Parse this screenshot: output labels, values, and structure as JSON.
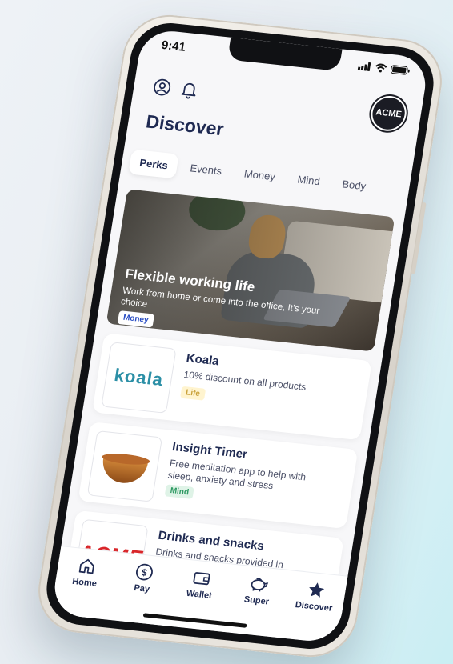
{
  "status": {
    "time": "9:41"
  },
  "header": {
    "title": "Discover",
    "logo_text": "ACME"
  },
  "tabs": [
    {
      "label": "Perks",
      "active": true
    },
    {
      "label": "Events",
      "active": false
    },
    {
      "label": "Money",
      "active": false
    },
    {
      "label": "Mind",
      "active": false
    },
    {
      "label": "Body",
      "active": false
    }
  ],
  "hero": {
    "title": "Flexible working life",
    "subtitle": "Work from home or come into the office, It's your choice",
    "badge": "Money"
  },
  "perks": [
    {
      "title": "Koala",
      "description": "10% discount on all products",
      "tag": "Life",
      "logo_text": "koala"
    },
    {
      "title": "Insight Timer",
      "description": "Free meditation app to help with sleep, anxiety and stress",
      "tag": "Mind"
    },
    {
      "title": "Drinks and snacks",
      "description": "Drinks and snacks provided in",
      "logo_text": "ACME"
    }
  ],
  "nav": [
    {
      "label": "Home",
      "icon": "home-icon"
    },
    {
      "label": "Pay",
      "icon": "dollar-icon"
    },
    {
      "label": "Wallet",
      "icon": "wallet-icon"
    },
    {
      "label": "Super",
      "icon": "piggy-bank-icon"
    },
    {
      "label": "Discover",
      "icon": "star-icon"
    }
  ]
}
